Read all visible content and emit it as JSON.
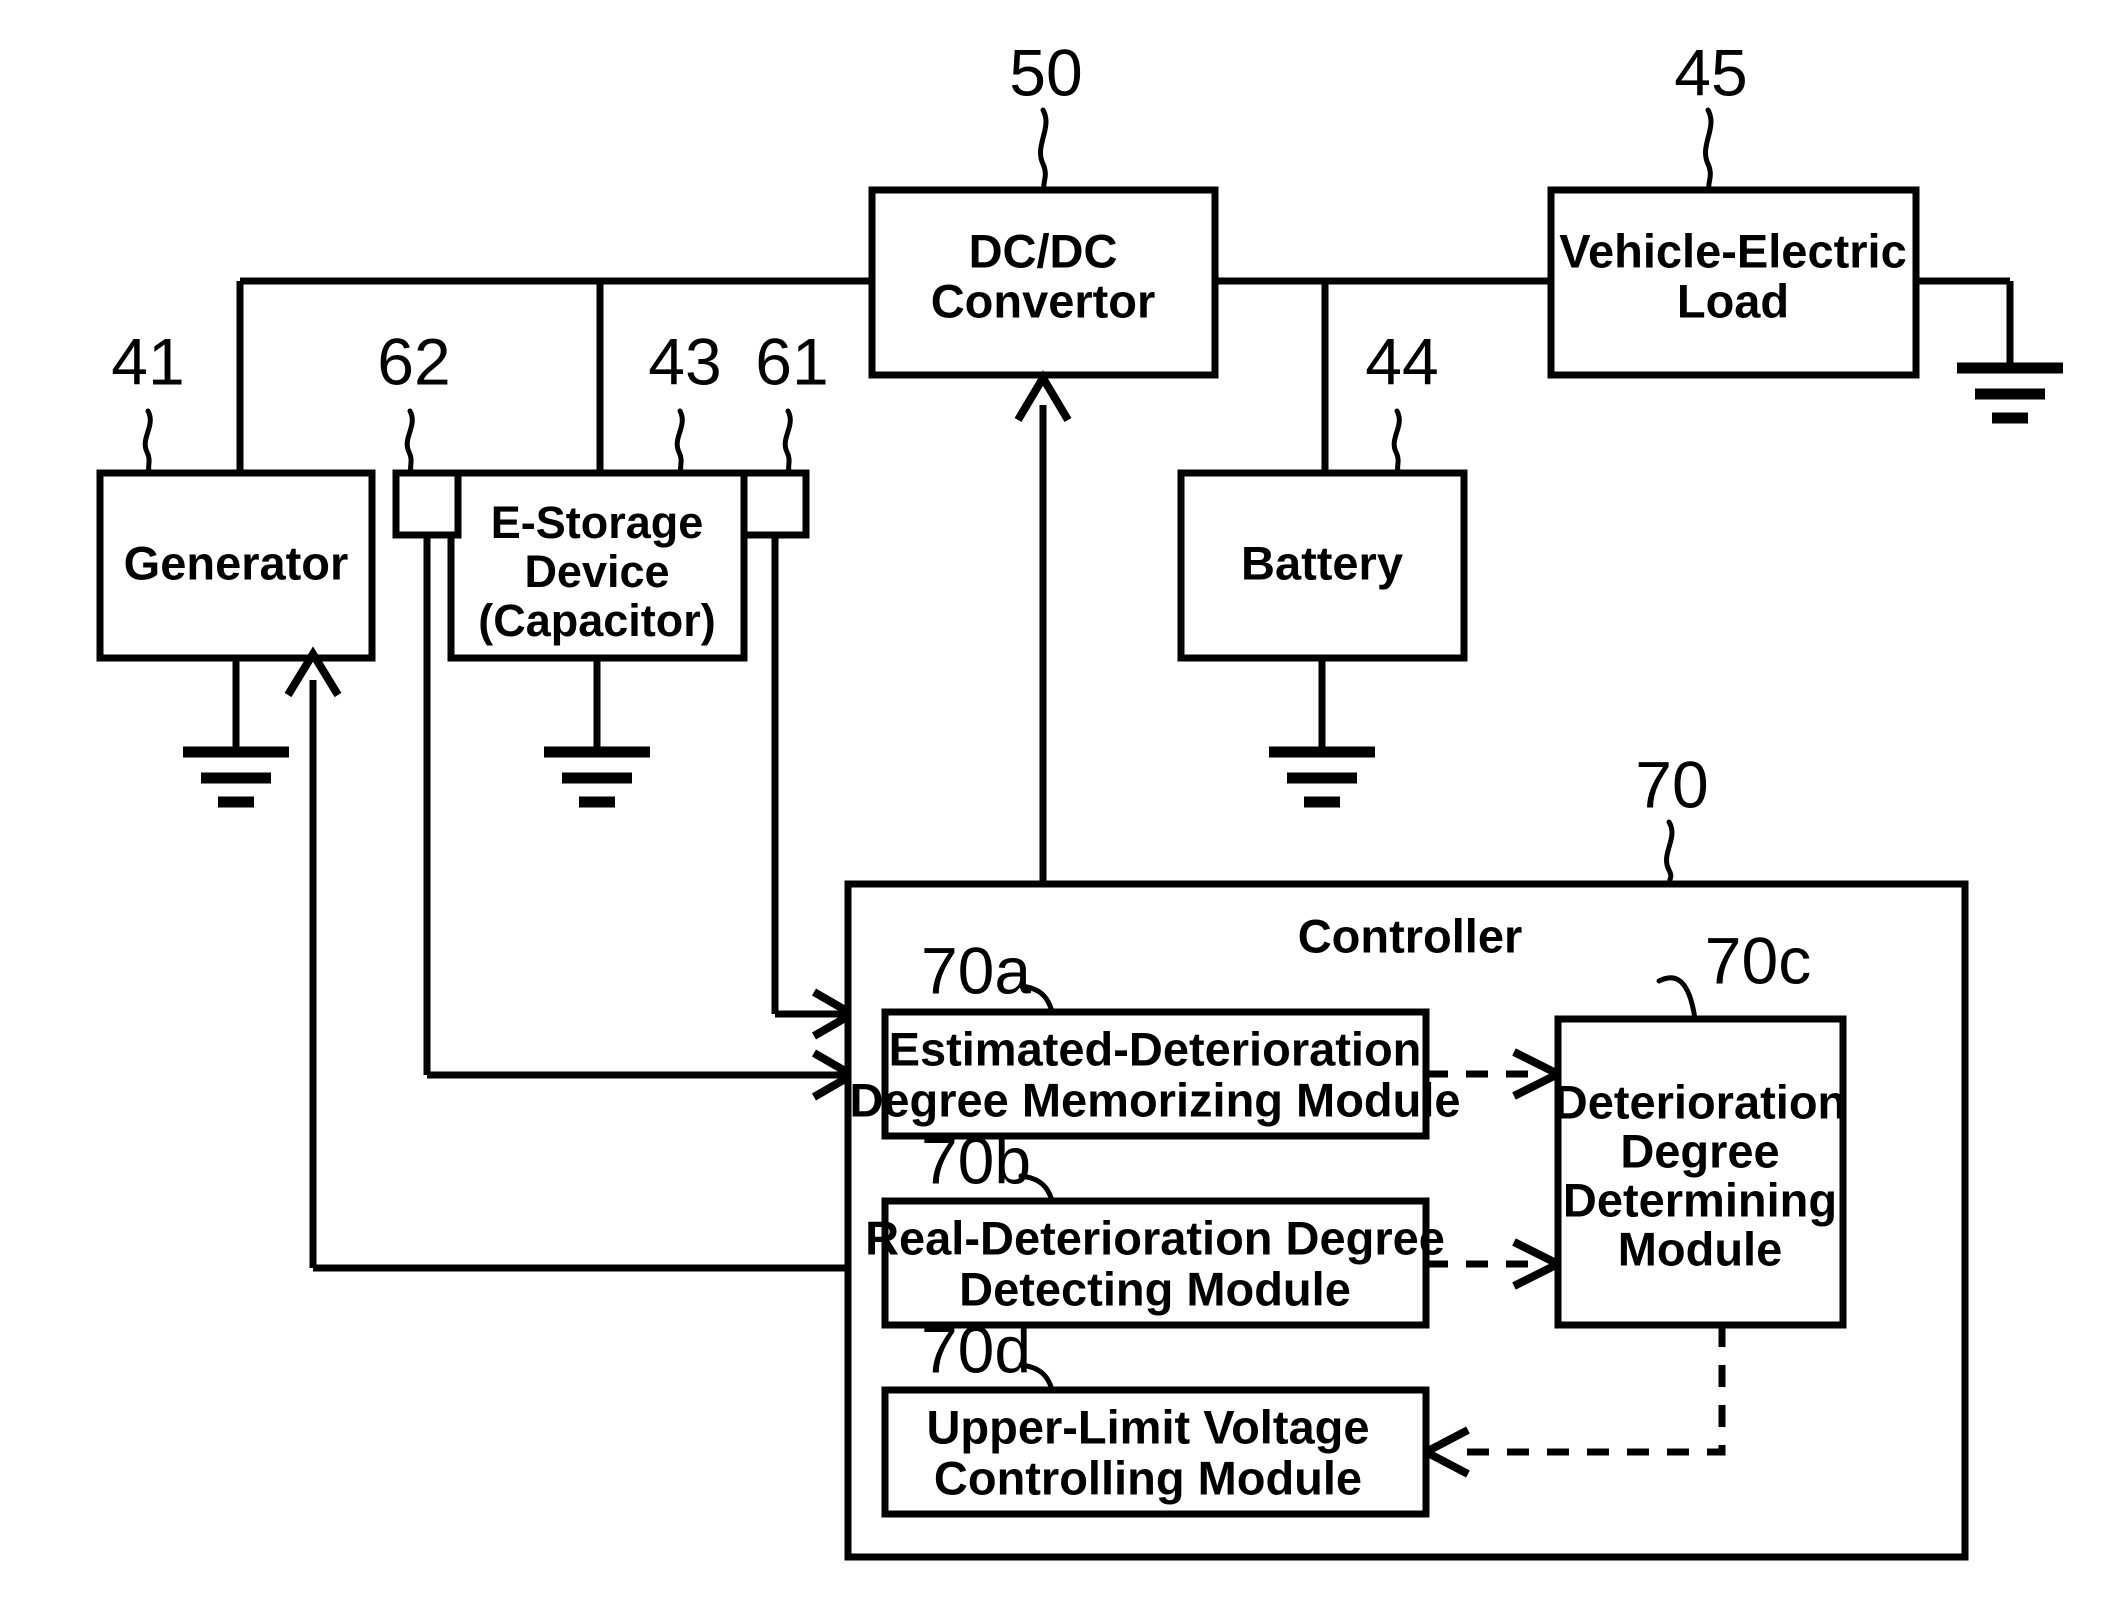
{
  "diagram": {
    "title": "Vehicle electric power supply system block diagram",
    "blocks": {
      "generator": {
        "label": "Generator",
        "ref": "41"
      },
      "e_storage": {
        "label_line1": "E-Storage",
        "label_line2": "Device",
        "label_line3": "(Capacitor)",
        "ref": "43"
      },
      "dcdc": {
        "label_line1": "DC/DC",
        "label_line2": "Convertor",
        "ref": "50"
      },
      "battery": {
        "label": "Battery",
        "ref": "44"
      },
      "vehicle_load": {
        "label_line1": "Vehicle-Electric",
        "label_line2": "Load",
        "ref": "45"
      },
      "sensor_left": {
        "ref": "62"
      },
      "sensor_right": {
        "ref": "61"
      },
      "controller": {
        "label": "Controller",
        "ref": "70"
      }
    },
    "modules": [
      {
        "ref": "70a",
        "label_line1": "Estimated-Deterioration",
        "label_line2": "Degree Memorizing Module"
      },
      {
        "ref": "70b",
        "label_line1": "Real-Deterioration Degree",
        "label_line2": "Detecting Module"
      },
      {
        "ref": "70c",
        "label_line1": "Deterioration",
        "label_line2": "Degree",
        "label_line3": "Determining",
        "label_line4": "Module"
      },
      {
        "ref": "70d",
        "label_line1": "Upper-Limit Voltage",
        "label_line2": "Controlling  Module"
      }
    ],
    "colors": {
      "line": "#000000",
      "background": "#ffffff",
      "text": "#000000"
    }
  }
}
